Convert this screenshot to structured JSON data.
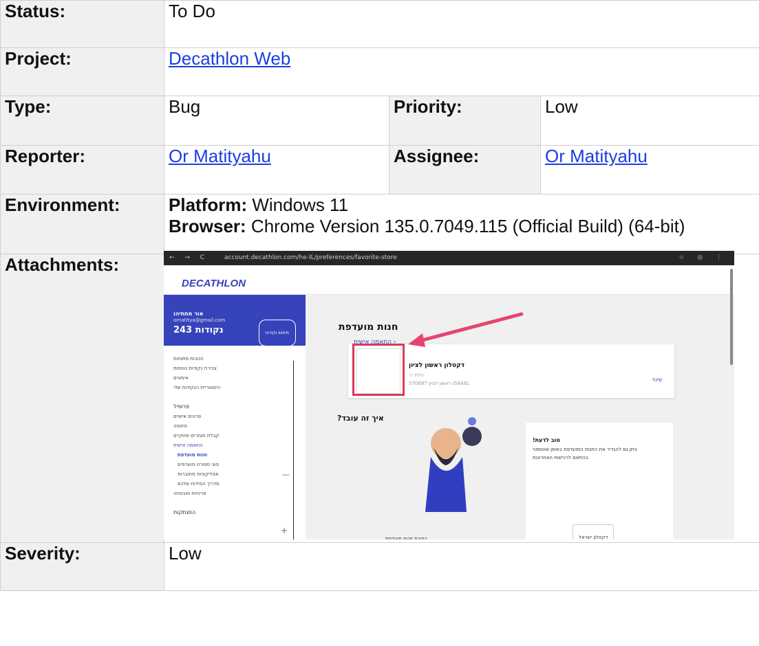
{
  "fields": {
    "status_label": "Status:",
    "status_value": "To Do",
    "project_label": "Project:",
    "project_value": "Decathlon Web",
    "type_label": "Type:",
    "type_value": "Bug",
    "priority_label": "Priority:",
    "priority_value": "Low",
    "reporter_label": "Reporter:",
    "reporter_value": "Or Matityahu",
    "assignee_label": "Assignee:",
    "assignee_value": "Or Matityahu",
    "environment_label": "Environment:",
    "platform_key": "Platform:",
    "platform_value": " Windows 11",
    "browser_key": "Browser:",
    "browser_value": " Chrome Version 135.0.7049.115 (Official Build) (64-bit)",
    "attachments_label": "Attachments:",
    "severity_label": "Severity:",
    "severity_value": "Low"
  },
  "attachment": {
    "browser_nav": "← → C",
    "url": "account.decathlon.com/he-IL/preferences/favorite-store",
    "browser_tools": "☆ ◎ ⋮",
    "logo": "DECATHLON",
    "user_name": "אור מתתיהו",
    "user_email": "ornatitya@gmail.com",
    "points": "243 נקודות",
    "points_button": "מימוש נקודות",
    "menu_rewards": [
      "הטבות פתוחות",
      "צבירת נקודות נוספות",
      "אימונים",
      "היסטוריית הנקודות שלי"
    ],
    "menu_profile_title": "פרופיל",
    "menu_profile": [
      "פרטים אישיים",
      "סיסמה",
      "קבלת חומרים שיווקיים"
    ],
    "menu_personal": "התאמה אישית",
    "menu_personal_sub": [
      "חנות מועדפת",
      "סוגי ספורט מועדפים",
      "אפליקציות מחוברות",
      "מדריך המידות שלכם"
    ],
    "menu_privacy": "פרטיות ואבטחה",
    "menu_logout": "התנתקות",
    "page_title": "חנות מועדפת",
    "breadcrumb": "התאמה אישית ›",
    "store_name": "דקטלון ראשון לציון",
    "store_line2": "הלח״ר",
    "store_line3": "570687 ראשון לציון ISRAEL",
    "change_link": "שינוי",
    "how_title": "?איך זה עובד",
    "tip_title": "!טוב לדעת",
    "tip_line1": "ניתן גם להגדיר את החנות המועדפת באופן אוטומטי",
    "tip_line2": "בהתאם לרכישות האחרונות",
    "tip_button": "דקטלון ישראל",
    "choose_store": "בחירת חנות מועדפת"
  }
}
